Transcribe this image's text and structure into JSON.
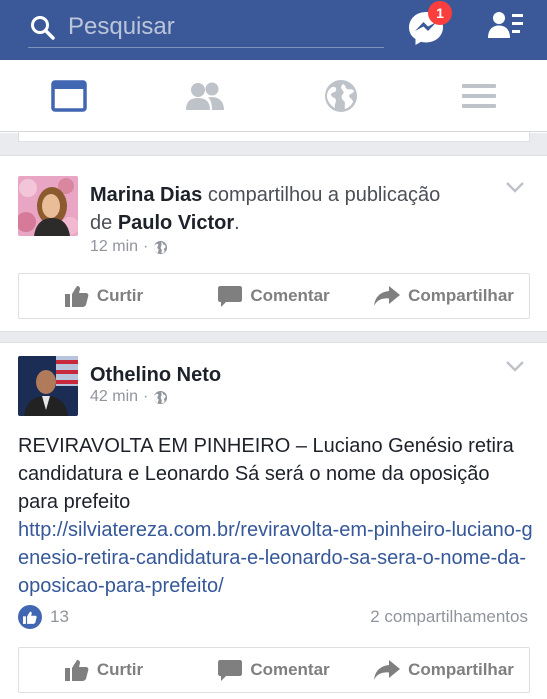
{
  "search": {
    "placeholder": "Pesquisar"
  },
  "notifications": {
    "messenger_badge": "1"
  },
  "posts": [
    {
      "author": "Marina Dias",
      "action_text": "compartilhou a publicação",
      "connector": "de",
      "shared_from": "Paulo Victor",
      "time": "12 min",
      "privacy_icon": "globe-icon"
    },
    {
      "author": "Othelino Neto",
      "time": "42 min",
      "privacy_icon": "globe-icon",
      "text": "REVIRAVOLTA EM PINHEIRO – Luciano Genésio retira candidatura e Leonardo Sá será o nome da oposição para prefeito",
      "link": "http://silviatereza.com.br/reviravolta-em-pinheiro-luciano-genesio-retira-candidatura-e-leonardo-sa-sera-o-nome-da-oposicao-para-prefeito/",
      "likes_count": "13",
      "shares": "2 compartilhamentos"
    }
  ],
  "actions": {
    "like": "Curtir",
    "comment": "Comentar",
    "share": "Compartilhar"
  },
  "colors": {
    "brand": "#3b5998",
    "link": "#365899",
    "muted": "#90949c"
  }
}
